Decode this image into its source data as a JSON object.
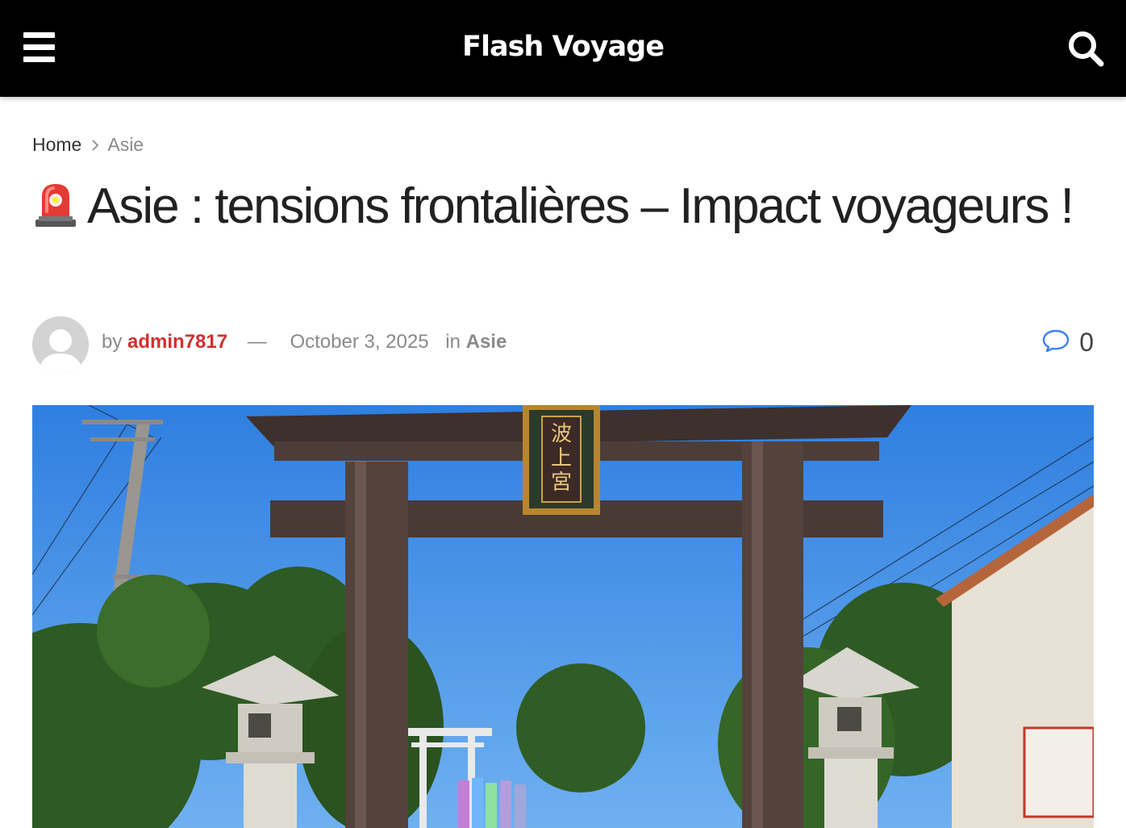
{
  "header": {
    "site_title": "Flash Voyage",
    "menu_icon": "hamburger-menu-icon",
    "search_icon": "search-icon",
    "background_color": "#000000"
  },
  "breadcrumb": {
    "home_label": "Home",
    "current_label": "Asie"
  },
  "article": {
    "title_emoji": "🚨",
    "title": "Asie : tensions frontalières – Impact voyageurs !",
    "meta": {
      "by_label": "by",
      "author": "admin7817",
      "separator": "—",
      "date": "October 3, 2025",
      "in_label": "in",
      "category": "Asie",
      "comment_count": "0",
      "author_color": "#d32f2f",
      "comment_icon_color": "#3b82f6"
    },
    "hero_image": {
      "characters": [
        "波",
        "上",
        "宮"
      ]
    }
  }
}
